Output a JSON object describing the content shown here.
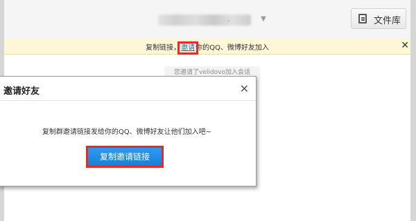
{
  "header": {
    "title_suffix": ".",
    "file_library_label": "文件库"
  },
  "notice": {
    "text_before": "复制链接，",
    "invite_link": "邀请",
    "text_after": "你的QQ、微博好友加入"
  },
  "system_message": "您邀请了velidovo加入会话",
  "dialog": {
    "title": "邀请好友",
    "message": "复制群邀请链接发给你的QQ、微博好友让他们加入吧~",
    "copy_button": "复制邀请链接"
  },
  "icons": {
    "caret": "caret-down-icon",
    "file": "document-icon",
    "close": "close-icon"
  },
  "colors": {
    "accent_blue": "#1a7fd8",
    "highlight_red": "#e32b2b",
    "notice_bg": "#fdf7d8"
  }
}
